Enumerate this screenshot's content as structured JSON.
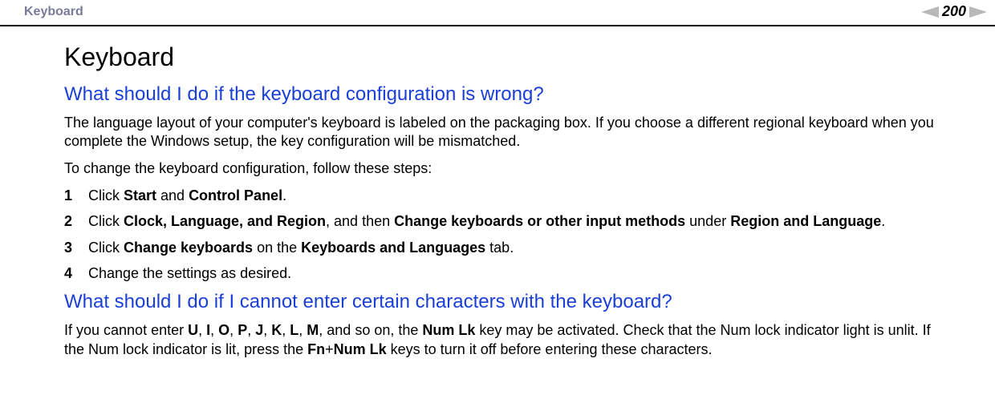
{
  "header": {
    "breadcrumb": "Keyboard",
    "page_number": "200"
  },
  "title": "Keyboard",
  "section1": {
    "heading": "What should I do if the keyboard configuration is wrong?",
    "para1": "The language layout of your computer's keyboard is labeled on the packaging box. If you choose a different regional keyboard when you complete the Windows setup, the key configuration will be mismatched.",
    "para2": "To change the keyboard configuration, follow these steps:",
    "steps": [
      {
        "n": "1",
        "html": "Click <b>Start</b> and <b>Control Panel</b>."
      },
      {
        "n": "2",
        "html": "Click <b>Clock, Language, and Region</b>, and then <b>Change keyboards or other input methods</b> under <b>Region and Language</b>."
      },
      {
        "n": "3",
        "html": "Click <b>Change keyboards</b> on the <b>Keyboards and Languages</b> tab."
      },
      {
        "n": "4",
        "html": "Change the settings as desired."
      }
    ]
  },
  "section2": {
    "heading": "What should I do if I cannot enter certain characters with the keyboard?",
    "para1_html": "If you cannot enter <b>U</b>, <b>I</b>, <b>O</b>, <b>P</b>, <b>J</b>, <b>K</b>, <b>L</b>, <b>M</b>, and so on, the <b>Num Lk</b> key may be activated. Check that the Num lock indicator light is unlit. If the Num lock indicator is lit, press the <b>Fn</b>+<b>Num Lk</b> keys to turn it off before entering these characters."
  }
}
